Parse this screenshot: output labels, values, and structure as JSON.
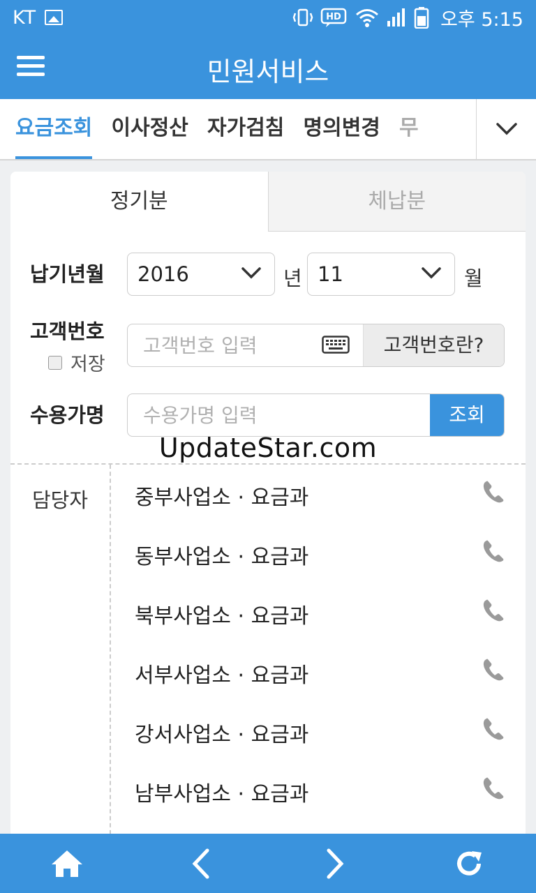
{
  "status_bar": {
    "carrier": "KT",
    "hd_label": "HD",
    "time": "오후 5:15"
  },
  "app_bar": {
    "title": "민원서비스"
  },
  "tabs": [
    {
      "label": "요금조회",
      "active": true
    },
    {
      "label": "이사정산",
      "active": false
    },
    {
      "label": "자가검침",
      "active": false
    },
    {
      "label": "명의변경",
      "active": false
    },
    {
      "label": "무",
      "active": false
    }
  ],
  "segments": {
    "regular": "정기분",
    "overdue": "체납분"
  },
  "form": {
    "due_month_label": "납기년월",
    "year_value": "2016",
    "year_unit": "년",
    "month_value": "11",
    "month_unit": "월",
    "customer_no_label": "고객번호",
    "save_label": "저장",
    "customer_no_placeholder": "고객번호 입력",
    "customer_no_help": "고객번호란?",
    "customer_name_label": "수용가명",
    "customer_name_placeholder": "수용가명 입력",
    "search_button": "조회"
  },
  "watermark": "UpdateStar.com",
  "contacts": {
    "label": "담당자",
    "items": [
      "중부사업소 · 요금과",
      "동부사업소 · 요금과",
      "북부사업소 · 요금과",
      "서부사업소 · 요금과",
      "강서사업소 · 요금과",
      "남부사업소 · 요금과"
    ]
  },
  "colors": {
    "primary": "#3a93dd",
    "tab_active": "#3a93dd"
  }
}
